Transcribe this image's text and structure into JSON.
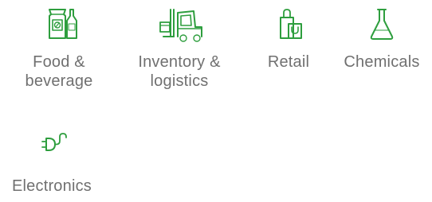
{
  "accent_color": "#2e9e3e",
  "text_color": "#707070",
  "industries": [
    {
      "icon": "food-beverage-icon",
      "label_line1": "Food &",
      "label_line2": "beverage"
    },
    {
      "icon": "forklift-icon",
      "label_line1": "Inventory &",
      "label_line2": "logistics"
    },
    {
      "icon": "shopping-bag-icon",
      "label_line1": "Retail",
      "label_line2": ""
    },
    {
      "icon": "flask-icon",
      "label_line1": "Chemicals",
      "label_line2": ""
    },
    {
      "icon": "plug-icon",
      "label_line1": "Electronics",
      "label_line2": ""
    }
  ]
}
